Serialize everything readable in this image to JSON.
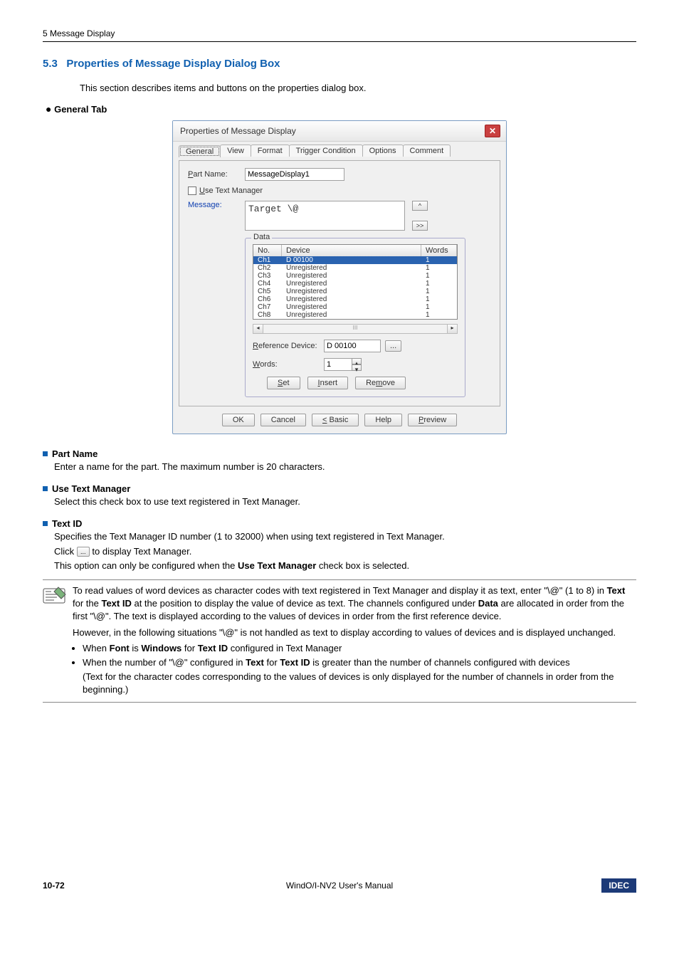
{
  "header": {
    "chapter": "5 Message Display"
  },
  "section": {
    "number": "5.3",
    "title": "Properties of Message Display Dialog Box",
    "intro": "This section describes items and buttons on the properties dialog box."
  },
  "tab_heading": {
    "bullet": "●",
    "label": "General",
    "suffix": " Tab"
  },
  "dialog": {
    "title": "Properties of Message Display",
    "tabs": [
      "General",
      "View",
      "Format",
      "Trigger Condition",
      "Options",
      "Comment"
    ],
    "part_name": {
      "label_u": "P",
      "label_rest": "art Name:",
      "value": "MessageDisplay1"
    },
    "use_text_manager": {
      "u": "U",
      "rest": "se Text Manager"
    },
    "message": {
      "label": "Message:",
      "text": "Target  \\@"
    },
    "arrows": {
      "up": "^",
      "down": ">>"
    },
    "fieldset_legend": "Data",
    "table": {
      "headers": [
        "No.",
        "Device",
        "Words"
      ],
      "rows": [
        {
          "no": "Ch1",
          "dev": "D 00100",
          "words": "1",
          "selected": true
        },
        {
          "no": "Ch2",
          "dev": "Unregistered",
          "words": "1"
        },
        {
          "no": "Ch3",
          "dev": "Unregistered",
          "words": "1"
        },
        {
          "no": "Ch4",
          "dev": "Unregistered",
          "words": "1"
        },
        {
          "no": "Ch5",
          "dev": "Unregistered",
          "words": "1"
        },
        {
          "no": "Ch6",
          "dev": "Unregistered",
          "words": "1"
        },
        {
          "no": "Ch7",
          "dev": "Unregistered",
          "words": "1"
        },
        {
          "no": "Ch8",
          "dev": "Unregistered",
          "words": "1"
        }
      ]
    },
    "scroll": {
      "left": "◂",
      "right": "▸",
      "mid": "III"
    },
    "ref_device": {
      "u": "R",
      "rest": "eference Device:",
      "value": "D 00100",
      "browse": "..."
    },
    "words": {
      "u": "W",
      "rest": "ords:",
      "value": "1"
    },
    "set": {
      "u": "S",
      "rest": "et"
    },
    "insert": {
      "u": "I",
      "rest": "nsert"
    },
    "remove": {
      "label": "Re",
      "u": "m",
      "rest": "ove"
    },
    "bottom": {
      "ok": "OK",
      "cancel": "Cancel",
      "basic": {
        "u": "<",
        "rest": " Basic"
      },
      "help": "Help",
      "preview": {
        "u": "P",
        "rest": "review"
      }
    }
  },
  "sub_partname": {
    "title": "Part Name",
    "body": "Enter a name for the part. The maximum number is 20 characters."
  },
  "sub_utm": {
    "title": "Use Text Manager",
    "body": "Select this check box to use text registered in Text Manager."
  },
  "sub_textid": {
    "title": "Text ID",
    "body1": "Specifies the Text Manager ID number (1 to 32000) when using text registered in Text Manager.",
    "body2a": "Click ",
    "btn": "...",
    "body2b": " to display Text Manager.",
    "body3a": "This option can only be configured when the ",
    "body3b": "Use Text Manager",
    "body3c": " check box is selected."
  },
  "note": {
    "p1a": "To read values of word devices as character codes with text registered in Text Manager and display it as text, enter \"\\@\" (1 to 8) in ",
    "p1b": "Text",
    "p1c": " for the ",
    "p1d": "Text ID",
    "p1e": " at the position to display the value of device as text. The channels configured under ",
    "p1f": "Data",
    "p1g": " are allocated in order from the first \"\\@\". The text is displayed according to the values of devices in order from the first reference device.",
    "p2": "However, in the following situations \"\\@\" is not handled as text to display according to values of devices and is displayed unchanged.",
    "b1a": "When ",
    "b1b": "Font",
    "b1c": " is ",
    "b1d": "Windows",
    "b1e": " for ",
    "b1f": "Text ID",
    "b1g": " configured in Text Manager",
    "b2a": "When the number of \"\\@\" configured in ",
    "b2b": "Text",
    "b2c": " for ",
    "b2d": "Text ID",
    "b2e": " is greater than the number of channels configured with devices",
    "b2f": "(Text for the character codes corresponding to the values of devices is only displayed for the number of channels in order from the beginning.)"
  },
  "footer": {
    "page": "10-72",
    "center": "WindO/I-NV2 User's Manual",
    "brand": "IDEC"
  }
}
